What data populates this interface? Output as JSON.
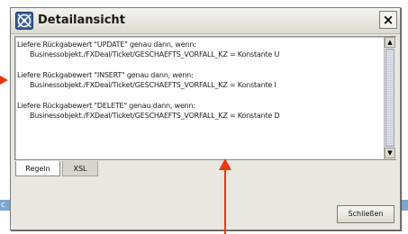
{
  "window": {
    "title": "Detailansicht",
    "close_glyph": "×",
    "app_icon": "component-icon"
  },
  "rules": [
    {
      "line1": "Liefere Rückgabewert \"UPDATE\" genau dann, wenn:",
      "line2": "Businessobjekt./FXDeal/Ticket/GESCHAEFTS_VORFALL_KZ = Konstante U"
    },
    {
      "line1": "Liefere Rückgabewert \"INSERT\" genau dann, wenn:",
      "line2": "Businessobjekt./FXDeal/Ticket/GESCHAEFTS_VORFALL_KZ = Konstante I"
    },
    {
      "line1": "Liefere Rückgabewert \"DELETE\" genau dann, wenn:",
      "line2": "Businessobjekt./FXDeal/Ticket/GESCHAEFTS_VORFALL_KZ = Konstante D"
    }
  ],
  "scrollbar": {
    "up_glyph": "▲",
    "down_glyph": "▼"
  },
  "tabs": [
    {
      "label": "Regeln",
      "active": true
    },
    {
      "label": "XSL",
      "active": false
    }
  ],
  "buttons": {
    "close_label": "Schließen"
  },
  "background": {
    "strip_text": "c"
  },
  "colors": {
    "annotation_arrow": "#e8380d",
    "background_strip": "#7aa6cf",
    "dialog_bg": "#e9e7e0"
  }
}
